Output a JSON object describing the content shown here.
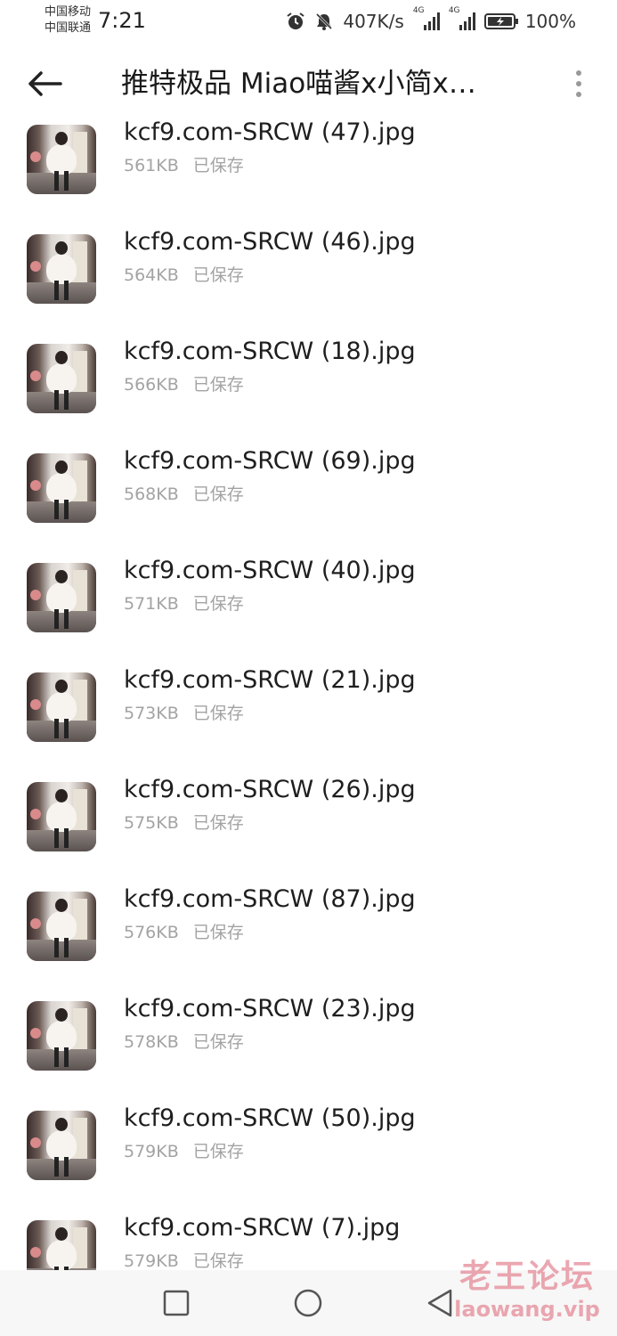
{
  "status_bar": {
    "carrier_1": "中国移动",
    "carrier_2": "中国联通",
    "time": "7:21",
    "network_speed": "407K/s",
    "signal_1_label": "4G",
    "signal_2_label": "4G",
    "battery": "100%",
    "icons": [
      "alarm-icon",
      "bell-muted-icon",
      "signal-4g-icon",
      "signal-4g-icon",
      "battery-charging-icon"
    ]
  },
  "app_bar": {
    "title": "推特极品 Miao喵酱x小简x…",
    "back_icon": "arrow-left-icon",
    "more_icon": "more-vertical-icon"
  },
  "files": [
    {
      "name": "kcf9.com-SRCW (47).jpg",
      "size": "561KB",
      "status": "已保存"
    },
    {
      "name": "kcf9.com-SRCW (46).jpg",
      "size": "564KB",
      "status": "已保存"
    },
    {
      "name": "kcf9.com-SRCW (18).jpg",
      "size": "566KB",
      "status": "已保存"
    },
    {
      "name": "kcf9.com-SRCW (69).jpg",
      "size": "568KB",
      "status": "已保存"
    },
    {
      "name": "kcf9.com-SRCW (40).jpg",
      "size": "571KB",
      "status": "已保存"
    },
    {
      "name": "kcf9.com-SRCW (21).jpg",
      "size": "573KB",
      "status": "已保存"
    },
    {
      "name": "kcf9.com-SRCW (26).jpg",
      "size": "575KB",
      "status": "已保存"
    },
    {
      "name": "kcf9.com-SRCW (87).jpg",
      "size": "576KB",
      "status": "已保存"
    },
    {
      "name": "kcf9.com-SRCW (23).jpg",
      "size": "578KB",
      "status": "已保存"
    },
    {
      "name": "kcf9.com-SRCW (50).jpg",
      "size": "579KB",
      "status": "已保存"
    },
    {
      "name": "kcf9.com-SRCW (7).jpg",
      "size": "579KB",
      "status": "已保存"
    }
  ],
  "nav_bar": {
    "icons": [
      "nav-recent-icon",
      "nav-home-icon",
      "nav-back-icon"
    ]
  },
  "watermark": {
    "line_1": "老王论坛",
    "line_2": "laowang.vip"
  },
  "colors": {
    "text_primary": "#1e1e1e",
    "text_secondary": "#a3a3a3",
    "nav_background": "#f7f7f7",
    "watermark": "#e58a98"
  }
}
